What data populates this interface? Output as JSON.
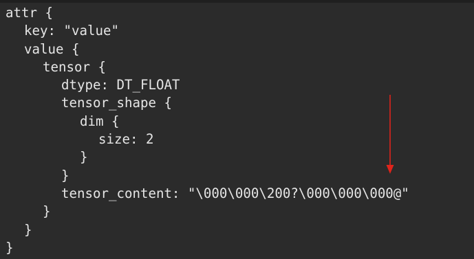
{
  "code_lines": [
    "attr {",
    "key: \"value\"",
    "value {",
    "tensor {",
    "dtype: DT_FLOAT",
    "tensor_shape {",
    "dim {",
    "size: 2",
    "}",
    "}",
    "tensor_content: \"\\000\\000\\200?\\000\\000\\000@\"",
    "}",
    "}",
    "}"
  ],
  "colors": {
    "background": "#2b2b2b",
    "text": "#e6e6e6",
    "arrow": "#e0241b"
  },
  "annotation": {
    "icon": "arrow-down-icon"
  }
}
